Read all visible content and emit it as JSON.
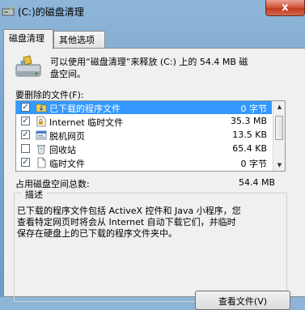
{
  "window": {
    "title": "(C:)的磁盘清理",
    "close_icon": "close-icon",
    "close_glyph": "x"
  },
  "tabs": [
    {
      "label": "磁盘清理",
      "active": true
    },
    {
      "label": "其他选项",
      "active": false
    }
  ],
  "summary": {
    "icon": "disk-cleanup-icon",
    "text": "可以使用“磁盘清理”来释放 (C:) 上的 54.4 MB 磁\n盘空间。"
  },
  "files_label": "要删除的文件(F):",
  "files": [
    {
      "checked": true,
      "icon": "download-folder-icon",
      "name": "已下载的程序文件",
      "size": "0 字节",
      "selected": true
    },
    {
      "checked": true,
      "icon": "document-lock-icon",
      "name": "Internet 临时文件",
      "size": "35.3 MB",
      "selected": false
    },
    {
      "checked": true,
      "icon": "offline-page-icon",
      "name": "脱机网页",
      "size": "13.5 KB",
      "selected": false
    },
    {
      "checked": false,
      "icon": "recycle-bin-icon",
      "name": "回收站",
      "size": "65.4 KB",
      "selected": false
    },
    {
      "checked": true,
      "icon": "temp-file-icon",
      "name": "临时文件",
      "size": "0 字节",
      "selected": false
    }
  ],
  "total": {
    "label": "占用磁盘空间总数:",
    "value": "54.4 MB"
  },
  "description": {
    "title": "描述",
    "text": "已下载的程序文件包括 ActiveX 控件和 Java 小程序，您\n查看特定网页时将会从 Internet 自动下载它们，并临时\n保存在硬盘上的已下载的程序文件夹中。"
  },
  "view_files_button": "查看文件(V)"
}
